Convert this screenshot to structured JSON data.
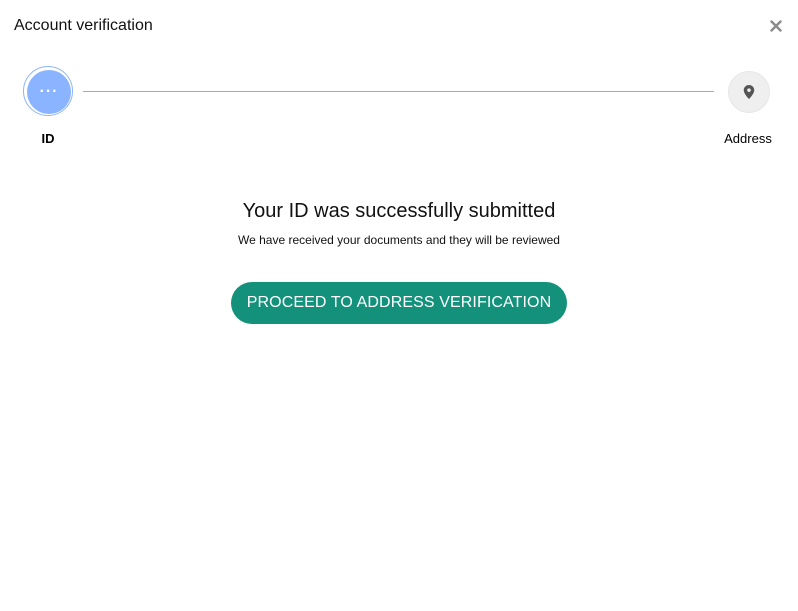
{
  "dialog": {
    "title": "Account verification",
    "close_icon": "close-icon"
  },
  "stepper": {
    "steps": [
      {
        "label": "ID",
        "state": "active",
        "icon": "more-dots-icon",
        "glyph": "···",
        "color": "#8ab4ff"
      },
      {
        "label": "Address",
        "state": "pending",
        "icon": "location-pin-icon",
        "color": "#efefef"
      }
    ]
  },
  "main": {
    "headline": "Your ID was successfully submitted",
    "subtext": "We have received your documents and they will be reviewed",
    "proceed_label": "PROCEED TO ADDRESS VERIFICATION",
    "accent_color": "#13917a"
  }
}
